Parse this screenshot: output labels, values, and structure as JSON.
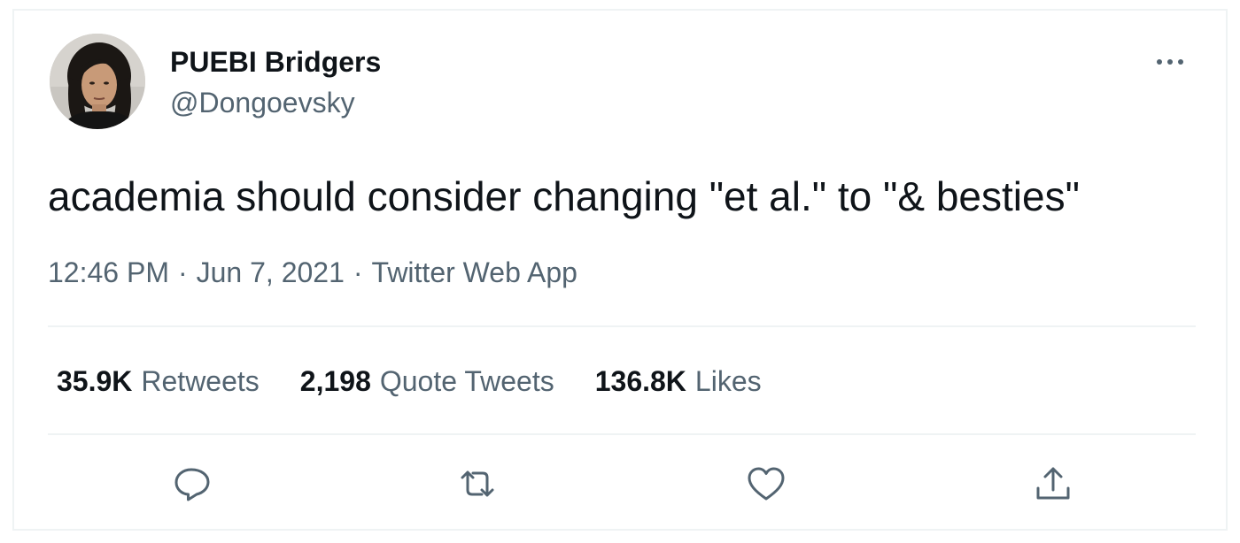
{
  "tweet": {
    "author": {
      "display_name": "PUEBI Bridgers",
      "handle": "@Dongoevsky"
    },
    "text": "academia should consider changing \"et al.\" to \"& besties\"",
    "time": "12:46 PM",
    "date": "Jun 7, 2021",
    "source": "Twitter Web App",
    "separator": "·",
    "stats": {
      "retweets": {
        "count": "35.9K",
        "label": "Retweets"
      },
      "quote_tweets": {
        "count": "2,198",
        "label": "Quote Tweets"
      },
      "likes": {
        "count": "136.8K",
        "label": "Likes"
      }
    }
  },
  "icons": {
    "more": "more-options-icon",
    "reply": "reply-icon",
    "retweet": "retweet-icon",
    "like": "heart-icon",
    "share": "share-icon"
  },
  "colors": {
    "text_primary": "#0f1419",
    "text_secondary": "#536471",
    "border": "#eff3f4"
  }
}
